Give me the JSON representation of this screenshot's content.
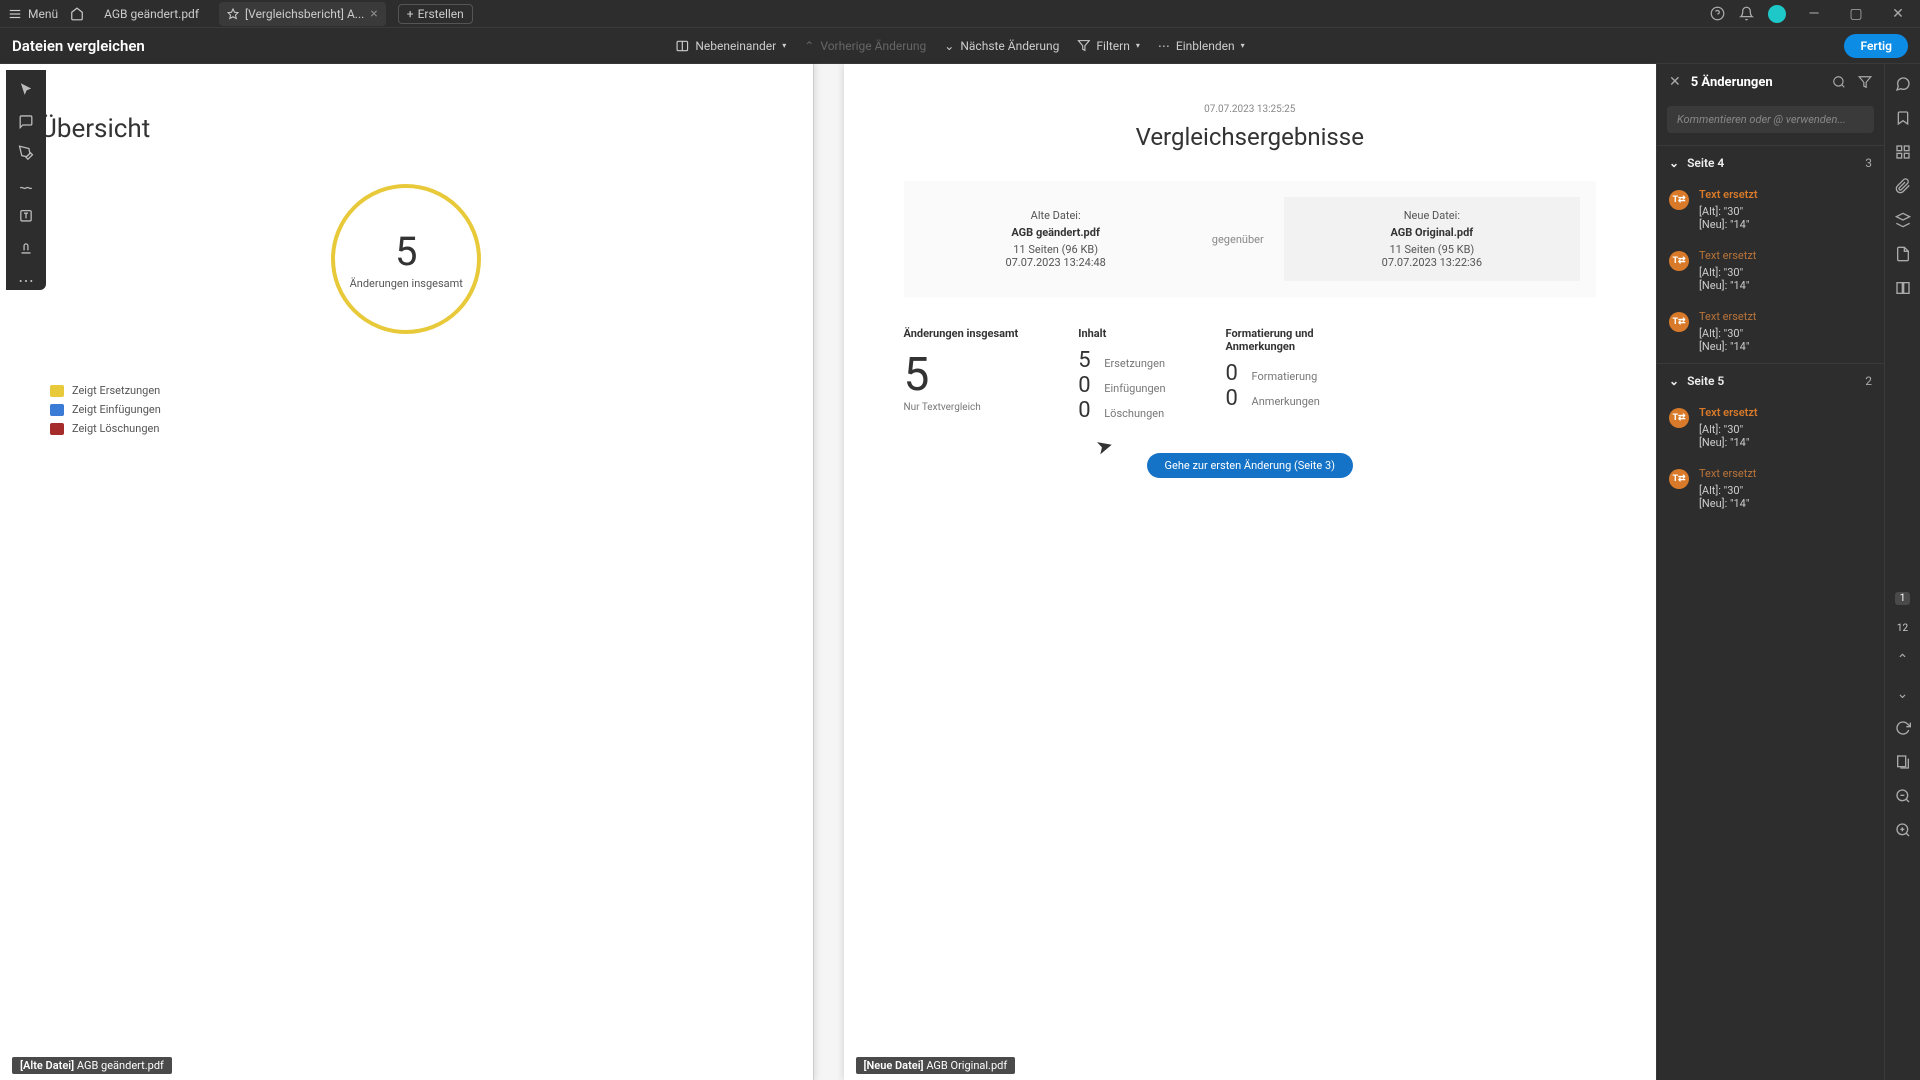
{
  "titlebar": {
    "menu": "Menü",
    "tabs": [
      {
        "label": "AGB geändert.pdf"
      },
      {
        "label": "[Vergleichsbericht] A..."
      }
    ],
    "create": "Erstellen"
  },
  "toolbar": {
    "title": "Dateien vergleichen",
    "sideBySide": "Nebeneinander",
    "prevChange": "Vorherige Änderung",
    "nextChange": "Nächste Änderung",
    "filter": "Filtern",
    "show": "Einblenden",
    "done": "Fertig"
  },
  "overview": {
    "heading": "Übersicht",
    "totalNum": "5",
    "totalLabel": "Änderungen insgesamt",
    "legend": {
      "replace": "Zeigt Ersetzungen",
      "insert": "Zeigt Einfügungen",
      "delete": "Zeigt Löschungen",
      "colors": {
        "replace": "#e8c93a",
        "insert": "#3a7bd5",
        "delete": "#a62c2c"
      }
    }
  },
  "results": {
    "timestamp": "07.07.2023 13:25:25",
    "heading": "Vergleichsergebnisse",
    "oldLabel": "Alte Datei:",
    "oldName": "AGB geändert.pdf",
    "oldMeta": "11 Seiten (96 KB)",
    "oldDate": "07.07.2023 13:24:48",
    "vs": "gegenüber",
    "newLabel": "Neue Datei:",
    "newName": "AGB Original.pdf",
    "newMeta": "11 Seiten (95 KB)",
    "newDate": "07.07.2023 13:22:36",
    "totalHeading": "Änderungen insgesamt",
    "totalBig": "5",
    "totalSub": "Nur Textvergleich",
    "contentHeading": "Inhalt",
    "content": {
      "replaceN": "5",
      "replaceL": "Ersetzungen",
      "insertN": "0",
      "insertL": "Einfügungen",
      "deleteN": "0",
      "deleteL": "Löschungen"
    },
    "fmtHeading": "Formatierung und Anmerkungen",
    "fmt": {
      "fmtN": "0",
      "fmtL": "Formatierung",
      "annN": "0",
      "annL": "Anmerkungen"
    },
    "goto": "Gehe zur ersten Änderung (Seite 3)"
  },
  "docBadges": {
    "oldPrefix": "[Alte Datei] ",
    "oldName": "AGB geändert.pdf",
    "newPrefix": "[Neue Datei] ",
    "newName": "AGB Original.pdf"
  },
  "panel": {
    "title": "5 Änderungen",
    "commentPlaceholder": "Kommentieren oder @ verwenden...",
    "pages": [
      {
        "label": "Seite 4",
        "count": "3",
        "items": [
          {
            "title": "Text ersetzt",
            "bold": true,
            "alt": "[Alt]: \"30\"",
            "neu": "[Neu]: \"14\""
          },
          {
            "title": "Text ersetzt",
            "bold": false,
            "alt": "[Alt]: \"30\"",
            "neu": "[Neu]: \"14\""
          },
          {
            "title": "Text ersetzt",
            "bold": false,
            "alt": "[Alt]: \"30\"",
            "neu": "[Neu]: \"14\""
          }
        ]
      },
      {
        "label": "Seite 5",
        "count": "2",
        "items": [
          {
            "title": "Text ersetzt",
            "bold": true,
            "alt": "[Alt]: \"30\"",
            "neu": "[Neu]: \"14\""
          },
          {
            "title": "Text ersetzt",
            "bold": false,
            "alt": "[Alt]: \"30\"",
            "neu": "[Neu]: \"14\""
          }
        ]
      }
    ]
  },
  "rail": {
    "pageCur": "1",
    "pageTotal": "12"
  }
}
